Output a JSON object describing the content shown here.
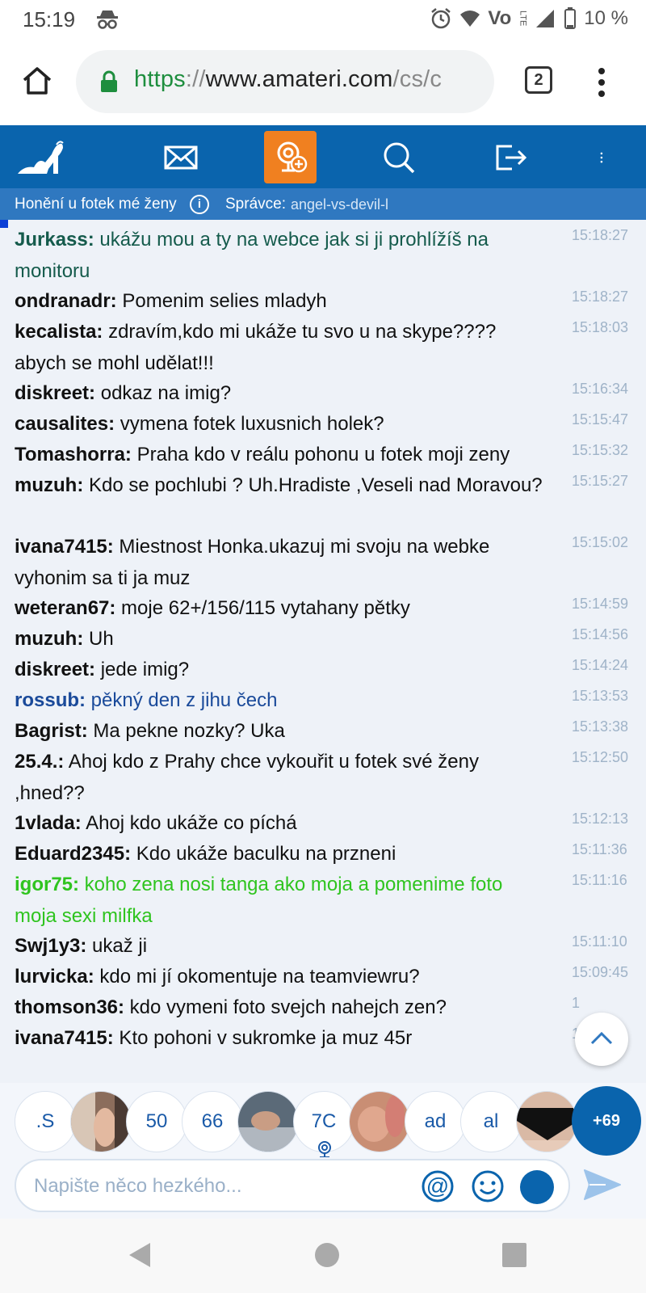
{
  "status_bar": {
    "time": "15:19",
    "battery": "10 %",
    "network": "LTE"
  },
  "browser": {
    "url_scheme": "https",
    "url_sep": "://",
    "url_host": "www.amateri.com",
    "url_path": "/cs/c",
    "tab_count": "2"
  },
  "site": {
    "brand_color": "#0a64ad",
    "accent_color": "#f08020",
    "room_name": "Honění u fotek mé ženy",
    "info_icon": "i",
    "admin_label": "Správce:",
    "admin_name": "angel-vs-devil-l"
  },
  "chat": {
    "messages": [
      {
        "nick": "Jurkass:",
        "text": " ukážu mou a ty na webce jak si ji prohlížíš na monitoru",
        "time": "15:18:27",
        "style": "green-dark"
      },
      {
        "nick": "ondranadr:",
        "text": " Pomenim selies mladyh",
        "time": "15:18:27",
        "style": "normal"
      },
      {
        "nick": "kecalista:",
        "text": " zdravím,kdo mi ukáže tu svo u na skype???? abych se mohl udělat!!!",
        "time": "15:18:03",
        "style": "normal"
      },
      {
        "nick": "diskreet:",
        "text": " odkaz na imig?",
        "time": "15:16:34",
        "style": "normal"
      },
      {
        "nick": "causalites:",
        "text": " vymena fotek luxusnich holek?",
        "time": "15:15:47",
        "style": "normal"
      },
      {
        "nick": "Tomashorra:",
        "text": " Praha kdo v reálu pohonu u fotek moji zeny",
        "time": "15:15:32",
        "style": "normal"
      },
      {
        "nick": "muzuh:",
        "text": " Kdo se pochlubi ? Uh.Hradiste ,Veseli nad Moravou?",
        "time": "15:15:27",
        "style": "normal"
      },
      {
        "nick": "ivana7415:",
        "text": " Miestnost Honka.ukazuj mi svoju na webke vyhonim sa ti ja muz",
        "time": "15:15:02",
        "style": "normal"
      },
      {
        "nick": "weteran67:",
        "text": " moje 62+/156/115 vytahany pětky",
        "time": "15:14:59",
        "style": "normal"
      },
      {
        "nick": "muzuh:",
        "text": " Uh",
        "time": "15:14:56",
        "style": "normal"
      },
      {
        "nick": "diskreet:",
        "text": " jede imig?",
        "time": "15:14:24",
        "style": "normal"
      },
      {
        "nick": "rossub:",
        "text": " pěkný den z jihu čech",
        "time": "15:13:53",
        "style": "blue"
      },
      {
        "nick": "Bagrist:",
        "text": " Ma pekne nozky? Uka",
        "time": "15:13:38",
        "style": "normal"
      },
      {
        "nick": "25.4.:",
        "text": " Ahoj kdo z Prahy chce vykouřit u fotek své ženy ,hned??",
        "time": "15:12:50",
        "style": "normal"
      },
      {
        "nick": "1vlada:",
        "text": " Ahoj kdo ukáže co píchá",
        "time": "15:12:13",
        "style": "normal"
      },
      {
        "nick": "Eduard2345:",
        "text": " Kdo ukáže baculku na przneni",
        "time": "15:11:36",
        "style": "normal"
      },
      {
        "nick": "igor75:",
        "text": " koho zena nosi tanga ako moja a pomenime foto moja sexi milfka",
        "time": "15:11:16",
        "style": "green"
      },
      {
        "nick": "Swj1y3:",
        "text": " ukaž ji",
        "time": "15:11:10",
        "style": "normal"
      },
      {
        "nick": "lurvicka:",
        "text": " kdo mi jí okomentuje na teamviewru?",
        "time": "15:09:45",
        "style": "normal"
      },
      {
        "nick": "thomson36:",
        "text": " kdo vymeni foto svejch nahejch zen?",
        "time": "1",
        "style": "normal"
      },
      {
        "nick": "ivana7415:",
        "text": " Kto pohoni v sukromke ja muz 45r",
        "time": "1",
        "style": "normal"
      }
    ]
  },
  "users": {
    "bubbles": [
      ".S",
      "50",
      "66",
      "7C",
      "ad",
      "al"
    ],
    "more": "+69"
  },
  "composer": {
    "placeholder": "Napište něco hezkého...",
    "at_symbol": "@"
  }
}
